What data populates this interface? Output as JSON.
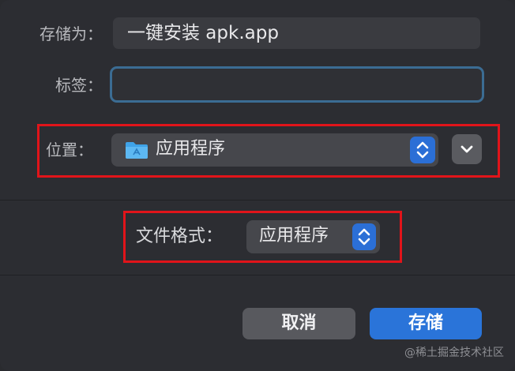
{
  "save_as": {
    "label": "存储为：",
    "value": "一键安装 apk.app"
  },
  "tags": {
    "label": "标签：",
    "value": ""
  },
  "location": {
    "label": "位置：",
    "value": "应用程序",
    "icon": "folder-icon"
  },
  "file_format": {
    "label": "文件格式：",
    "value": "应用程序"
  },
  "buttons": {
    "cancel": "取消",
    "save": "存储"
  },
  "watermark": "@稀土掘金技术社区",
  "colors": {
    "accent": "#2a74d9",
    "highlight": "#e1141a",
    "focus_ring": "#3b6c93"
  }
}
